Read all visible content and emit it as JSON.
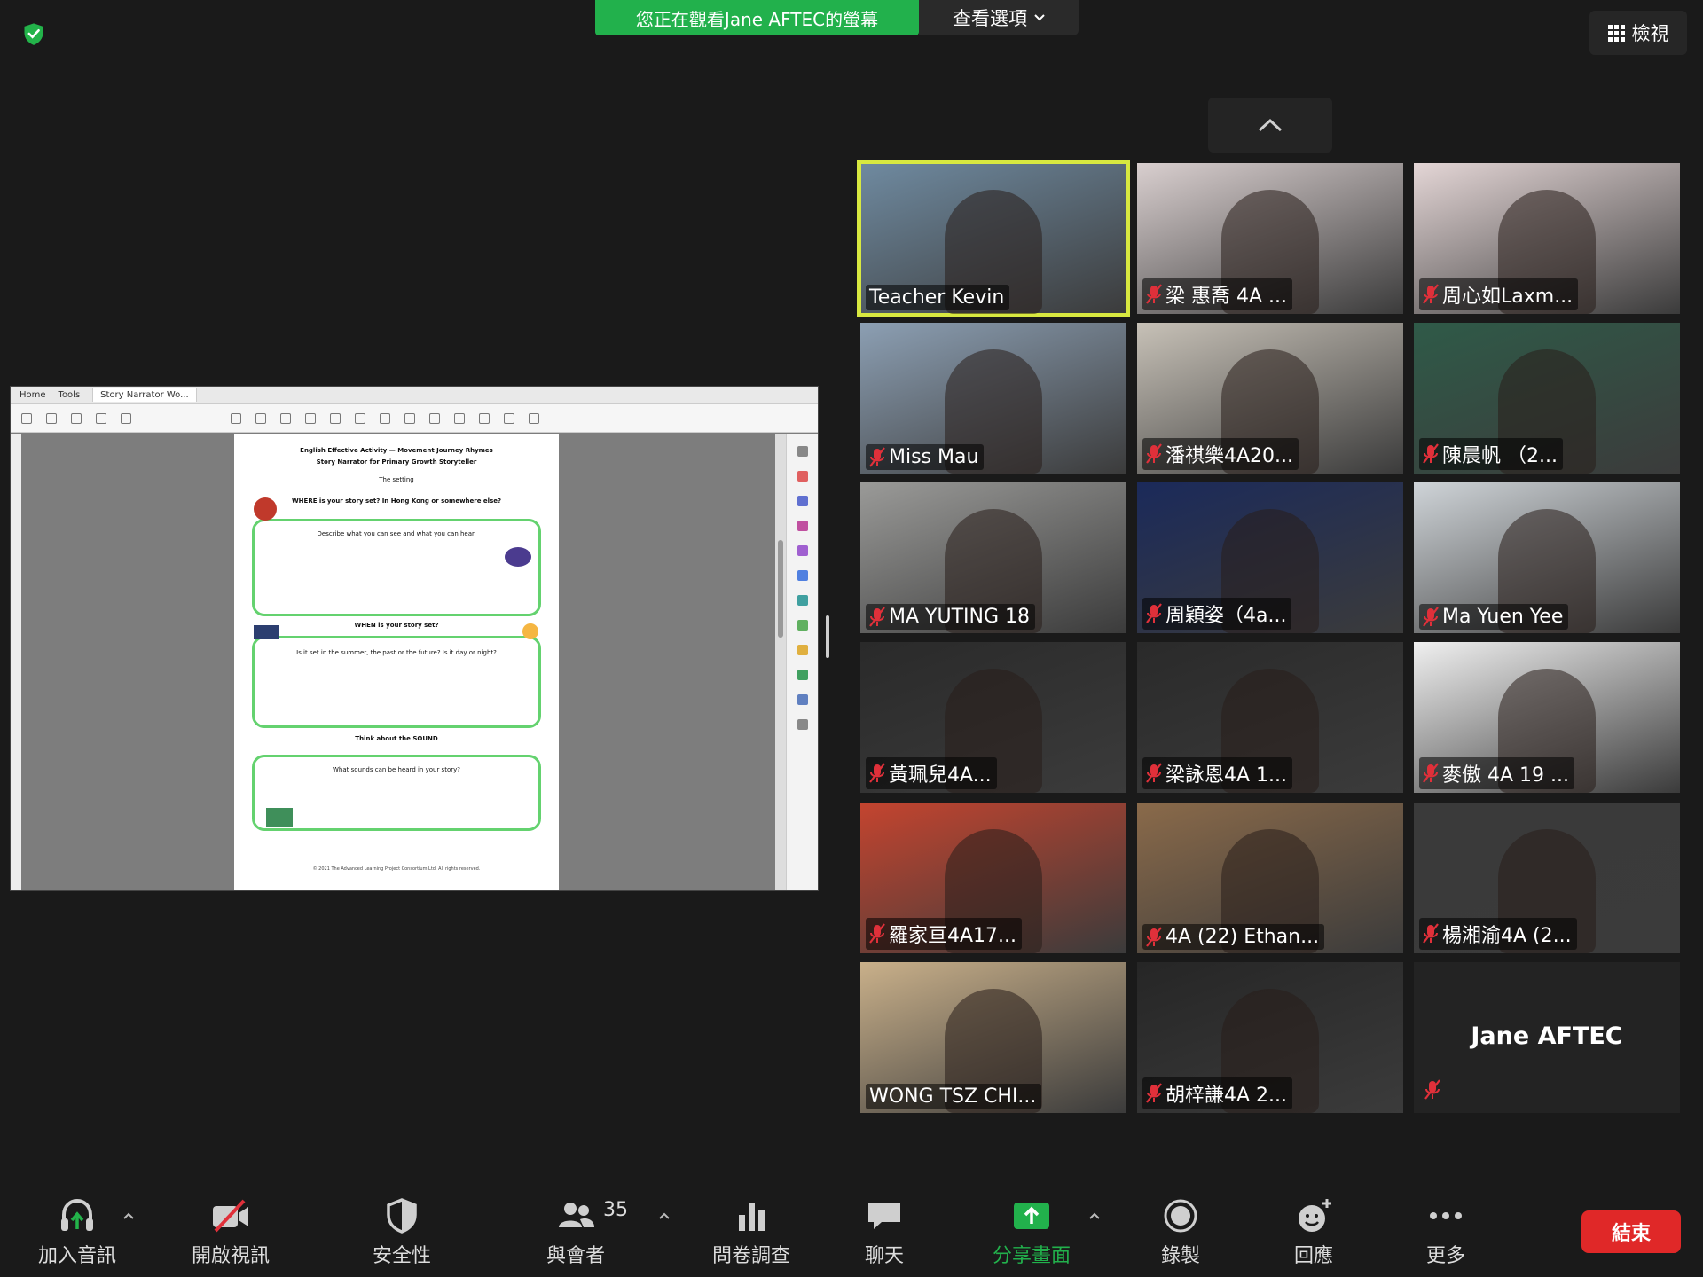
{
  "top": {
    "share_banner": "您正在觀看Jane AFTEC的螢幕",
    "view_options": "查看選項",
    "view_label": "檢視"
  },
  "shared_screen": {
    "tabs": [
      "Home",
      "Tools",
      "Story Narrator Wo..."
    ],
    "page": {
      "header1": "English Effective Activity — Movement Journey Rhymes",
      "header2": "Story Narrator for Primary Growth Storyteller",
      "line_sub": "The setting",
      "section1": "WHERE is your story set? In Hong Kong or somewhere else?",
      "box1_text": "Describe what you can see and what you can hear.",
      "section2": "WHEN is your story set?",
      "box2_text": "Is it set in the summer, the past or the future? Is it day or night?",
      "section3": "Think about the SOUND",
      "box3_text": "What sounds can be heard in your story?",
      "footer": "© 2021 The Advanced Learning Project Consortium Ltd. All rights reserved."
    }
  },
  "participants": [
    {
      "name": "Teacher Kevin",
      "muted": false,
      "active": true,
      "bg": "#6f8aa0"
    },
    {
      "name": "梁 惠喬 4A ...",
      "muted": true,
      "active": false,
      "bg": "#d9cfcf"
    },
    {
      "name": "周心如Laxm...",
      "muted": true,
      "active": false,
      "bg": "#e4d6d6"
    },
    {
      "name": "Miss Mau",
      "muted": true,
      "active": false,
      "bg": "#8c9fb3"
    },
    {
      "name": "潘祺樂4A20...",
      "muted": true,
      "active": false,
      "bg": "#c7c1b7"
    },
    {
      "name": "陳晨帆 （2...",
      "muted": true,
      "active": false,
      "bg": "#2f5a48"
    },
    {
      "name": "MA YUTING 18",
      "muted": true,
      "active": false,
      "bg": "#9a9a98"
    },
    {
      "name": "周穎姿（4a...",
      "muted": true,
      "active": false,
      "bg": "#1b2a5a"
    },
    {
      "name": "Ma Yuen Yee",
      "muted": true,
      "active": false,
      "bg": "#cfd4d8"
    },
    {
      "name": "黃珮兒4A...",
      "muted": true,
      "active": false,
      "bg": "#2a2a2a"
    },
    {
      "name": "梁詠恩4A 1...",
      "muted": true,
      "active": false,
      "bg": "#2a2a2a"
    },
    {
      "name": "麥傲 4A 19 ...",
      "muted": true,
      "active": false,
      "bg": "#f0f0f0"
    },
    {
      "name": "羅家亘4A17...",
      "muted": true,
      "active": false,
      "bg": "#c4442f"
    },
    {
      "name": "4A (22) Ethan...",
      "muted": true,
      "active": false,
      "bg": "#8a6a4a"
    },
    {
      "name": "楊湘渝4A (2...",
      "muted": true,
      "active": false,
      "bg": "#3a3a3a"
    },
    {
      "name": "WONG TSZ CHI...",
      "muted": false,
      "active": false,
      "bg": "#c9b08a"
    },
    {
      "name": "胡梓謙4A 2...",
      "muted": true,
      "active": false,
      "bg": "#262626"
    },
    {
      "name": "Jane AFTEC",
      "muted": true,
      "active": false,
      "bg": "#232323"
    }
  ],
  "toolbar": {
    "join_audio": "加入音訊",
    "start_video": "開啟視訊",
    "security": "安全性",
    "participants": "與會者",
    "participants_count": "35",
    "polls": "問卷調查",
    "chat": "聊天",
    "share_screen": "分享畫面",
    "record": "錄製",
    "reactions": "回應",
    "more": "更多",
    "end": "結束"
  },
  "colors": {
    "share_green": "#22b14c",
    "active_speaker": "#d8e840",
    "end_red": "#e02828",
    "muted_red": "#e0303a"
  }
}
